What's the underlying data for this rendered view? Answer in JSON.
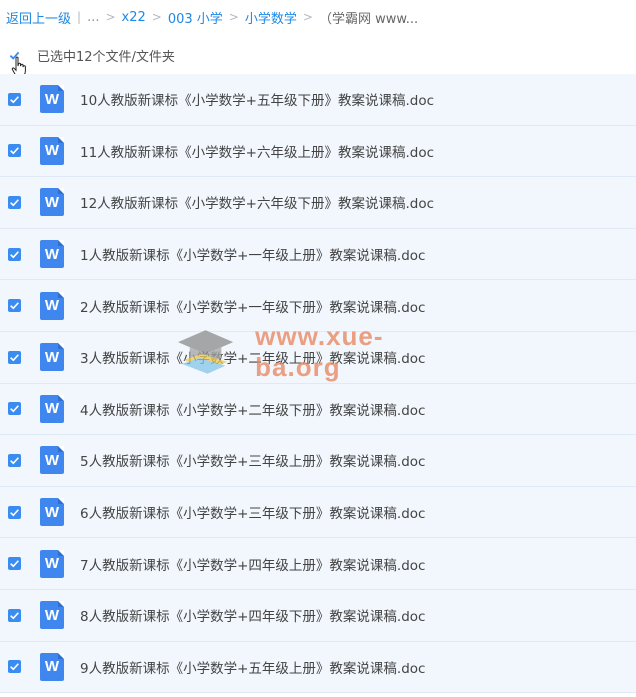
{
  "breadcrumb": {
    "back": "返回上一级",
    "ellipsis": "...",
    "items": [
      "x22",
      "003 小学",
      "小学数学"
    ],
    "current": "（学霸网 www..."
  },
  "selection": {
    "text": "已选中12个文件/文件夹"
  },
  "file_icon_letter": "W",
  "files": [
    {
      "name": "10人教版新课标《小学数学+五年级下册》教案说课稿.doc"
    },
    {
      "name": "11人教版新课标《小学数学+六年级上册》教案说课稿.doc"
    },
    {
      "name": "12人教版新课标《小学数学+六年级下册》教案说课稿.doc"
    },
    {
      "name": "1人教版新课标《小学数学+一年级上册》教案说课稿.doc"
    },
    {
      "name": "2人教版新课标《小学数学+一年级下册》教案说课稿.doc"
    },
    {
      "name": "3人教版新课标《小学数学+二年级上册》教案说课稿.doc"
    },
    {
      "name": "4人教版新课标《小学数学+二年级下册》教案说课稿.doc"
    },
    {
      "name": "5人教版新课标《小学数学+三年级上册》教案说课稿.doc"
    },
    {
      "name": "6人教版新课标《小学数学+三年级下册》教案说课稿.doc"
    },
    {
      "name": "7人教版新课标《小学数学+四年级上册》教案说课稿.doc"
    },
    {
      "name": "8人教版新课标《小学数学+四年级下册》教案说课稿.doc"
    },
    {
      "name": "9人教版新课标《小学数学+五年级上册》教案说课稿.doc"
    }
  ],
  "watermark": "www.xue-ba.org",
  "colors": {
    "accent": "#1e88e5",
    "checkbox": "#3b8cf1",
    "row_bg": "#f1f7fd",
    "doc_icon": "#3f87ee",
    "watermark": "#e9825a"
  }
}
